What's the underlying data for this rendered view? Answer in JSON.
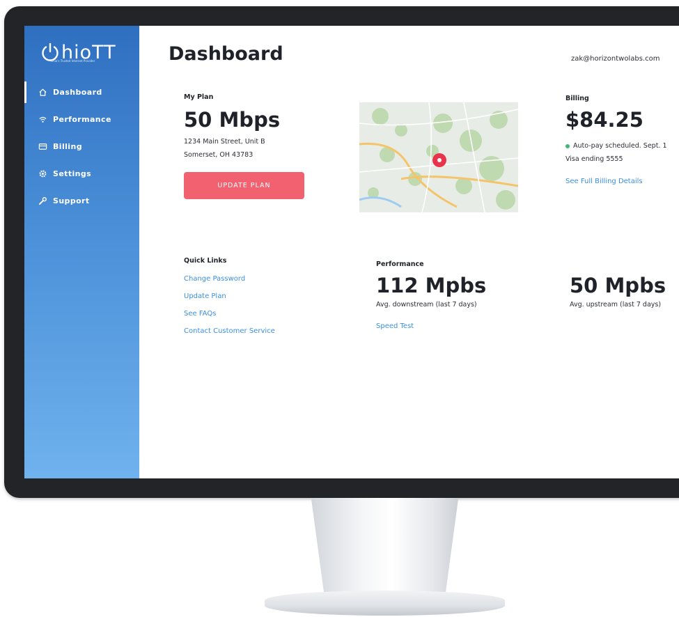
{
  "app": {
    "logo_text": "hioTT",
    "logo_tagline": "Ohio's Trusted Internet Provider"
  },
  "sidebar": {
    "items": [
      {
        "label": "Dashboard",
        "icon": "home-icon",
        "active": true
      },
      {
        "label": "Performance",
        "icon": "wifi-icon",
        "active": false
      },
      {
        "label": "Billing",
        "icon": "card-icon",
        "active": false
      },
      {
        "label": "Settings",
        "icon": "gear-icon",
        "active": false
      },
      {
        "label": "Support",
        "icon": "wrench-icon",
        "active": false
      }
    ]
  },
  "header": {
    "title": "Dashboard",
    "user_email": "zak@horizontwolabs.com"
  },
  "plan": {
    "label": "My Plan",
    "speed": "50 Mbps",
    "address_line1": "1234 Main Street,  Unit B",
    "address_line2": "Somerset, OH 43783",
    "button_label": "UPDATE PLAN"
  },
  "billing": {
    "label": "Billing",
    "amount": "$84.25",
    "autopay": "Auto-pay scheduled. Sept. 1",
    "card": "Visa ending 5555",
    "details_link": "See Full Billing Details"
  },
  "quick_links": {
    "label": "Quick Links",
    "items": [
      "Change Password",
      "Update Plan",
      "See FAQs",
      "Contact Customer Service"
    ]
  },
  "performance": {
    "label": "Performance",
    "downstream_value": "112 Mpbs",
    "downstream_caption": "Avg. downstream (last 7 days)",
    "upstream_value": "50 Mpbs",
    "upstream_caption": "Avg. upstream (last 7 days)",
    "speed_test_link": "Speed Test"
  },
  "colors": {
    "sidebar_top": "#2f6fc0",
    "sidebar_bottom": "#6fb2ee",
    "accent_button": "#f2616f",
    "link": "#3b8fe0",
    "status_ok": "#3fb87a",
    "map_pin": "#e8344a"
  }
}
